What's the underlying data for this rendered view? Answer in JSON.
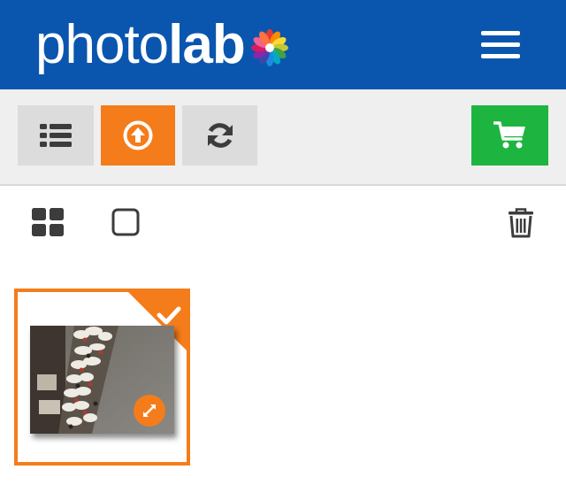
{
  "header": {
    "logo_light": "photo",
    "logo_bold": "lab",
    "menu_icon": "hamburger-icon"
  },
  "toolbar": {
    "list_icon": "list-icon",
    "upload_icon": "upload-icon",
    "refresh_icon": "refresh-icon",
    "cart_icon": "cart-icon"
  },
  "actions": {
    "grid_icon": "grid-icon",
    "select_icon": "checkbox-icon",
    "delete_icon": "trash-icon"
  },
  "photos": [
    {
      "selected": true,
      "expand_icon": "expand-icon",
      "check_icon": "check-icon"
    }
  ],
  "colors": {
    "header_bg": "#0a56ae",
    "accent_orange": "#f57c1a",
    "cart_green": "#1db540",
    "toolbar_bg": "#efefef",
    "button_grey": "#dcdcdc",
    "icon_dark": "#3c3c3c"
  }
}
